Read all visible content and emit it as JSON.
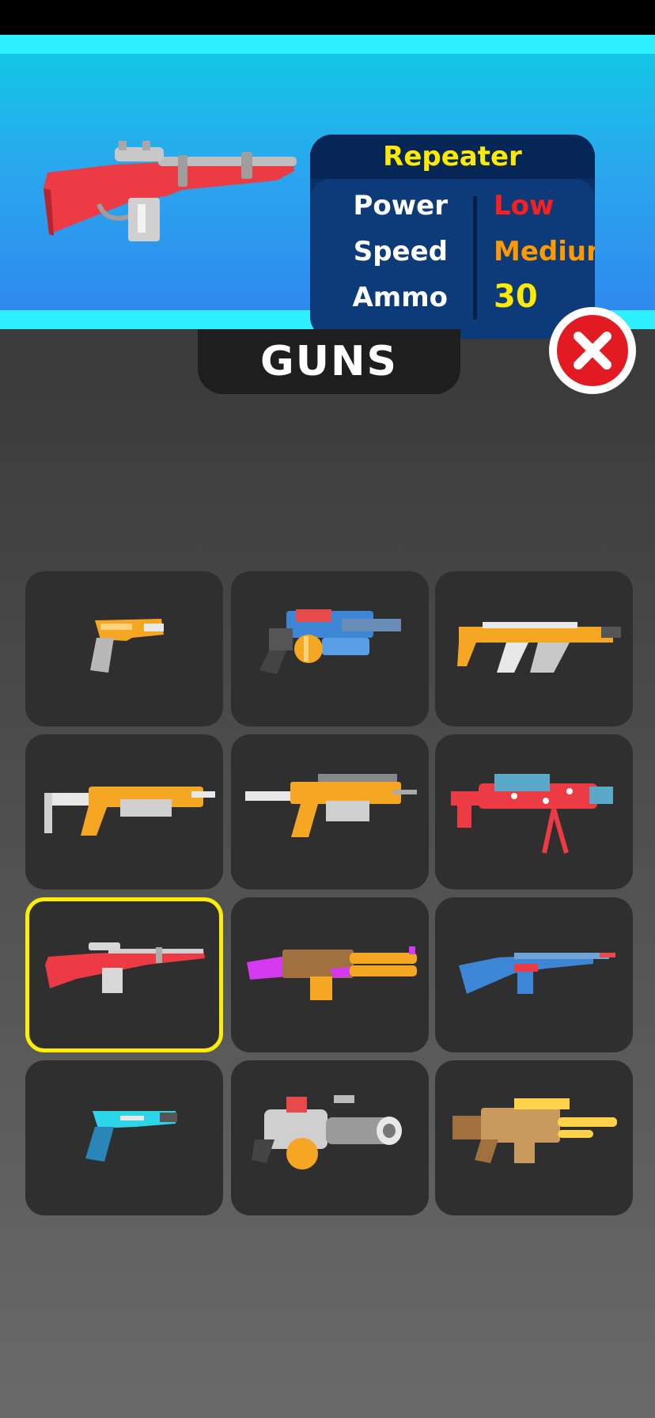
{
  "selected_weapon": {
    "name": "Repeater",
    "stats": [
      {
        "label": "Power",
        "value": "Low",
        "color": "#ff1e1e"
      },
      {
        "label": "Speed",
        "value": "Medium",
        "color": "#ff9900"
      },
      {
        "label": "Ammo",
        "value": "30",
        "color": "#ffea00"
      }
    ]
  },
  "section_title": "GUNS",
  "close_icon": "close-x-icon",
  "selected_index": 6,
  "guns": [
    {
      "icon": "orange-pistol-icon"
    },
    {
      "icon": "blue-drum-shotgun-icon"
    },
    {
      "icon": "orange-smg-icon"
    },
    {
      "icon": "white-orange-shotgun-icon"
    },
    {
      "icon": "orange-assault-rifle-icon"
    },
    {
      "icon": "red-blue-machine-gun-icon"
    },
    {
      "icon": "red-repeater-rifle-icon"
    },
    {
      "icon": "purple-brown-launcher-icon"
    },
    {
      "icon": "blue-rifle-icon"
    },
    {
      "icon": "cyan-pistol-icon"
    },
    {
      "icon": "gray-minigun-icon"
    },
    {
      "icon": "brown-gold-heavy-gun-icon"
    }
  ]
}
